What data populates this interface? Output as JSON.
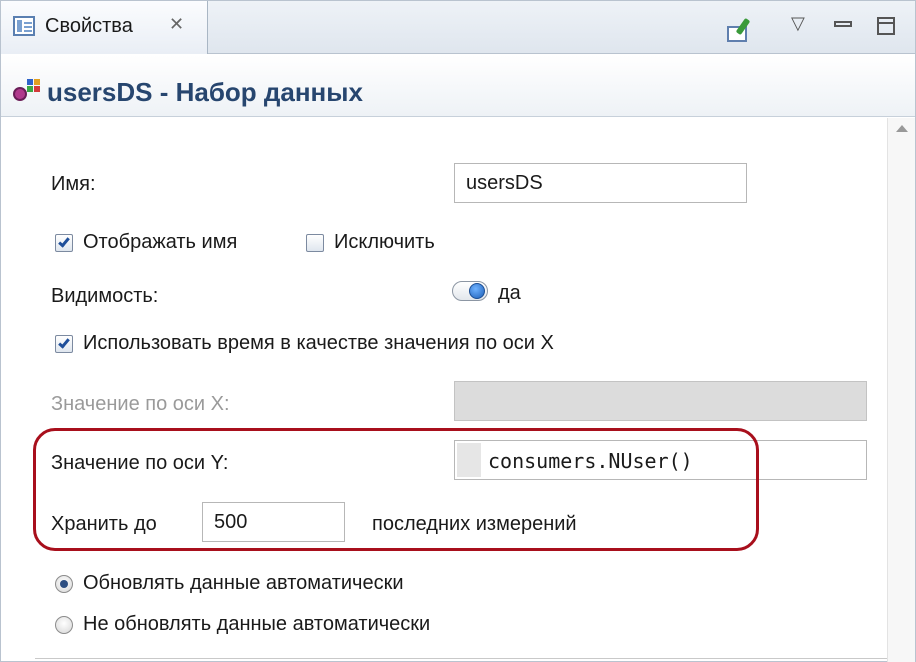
{
  "tab": {
    "label": "Свойства",
    "close_glyph": "✕"
  },
  "toolbar": {
    "icons": [
      "pin-editor-icon",
      "view-menu-icon",
      "minimize-icon",
      "maximize-icon"
    ],
    "menu_glyph": "▽"
  },
  "header": {
    "title": "usersDS - Набор данных",
    "icon": "dataset-icon"
  },
  "form": {
    "name_label": "Имя:",
    "name_value": "usersDS",
    "show_name_label": "Отображать имя",
    "show_name_checked": true,
    "exclude_label": "Исключить",
    "exclude_checked": false,
    "visibility_label": "Видимость:",
    "visibility_value": "да",
    "use_time_label": "Использовать время в качестве значения по оси X",
    "use_time_checked": true,
    "x_value_label": "Значение по оси X:",
    "x_value": "",
    "y_value_label": "Значение по оси Y:",
    "y_value": "consumers.NUser()",
    "keep_label": "Хранить до",
    "keep_value": "500",
    "keep_suffix": "последних измерений",
    "update_auto_label": "Обновлять данные автоматически",
    "update_manual_label": "Не обновлять данные автоматически",
    "update_mode": "auto"
  },
  "colors": {
    "highlight": "#a80f1c",
    "header_title": "#27466f"
  }
}
